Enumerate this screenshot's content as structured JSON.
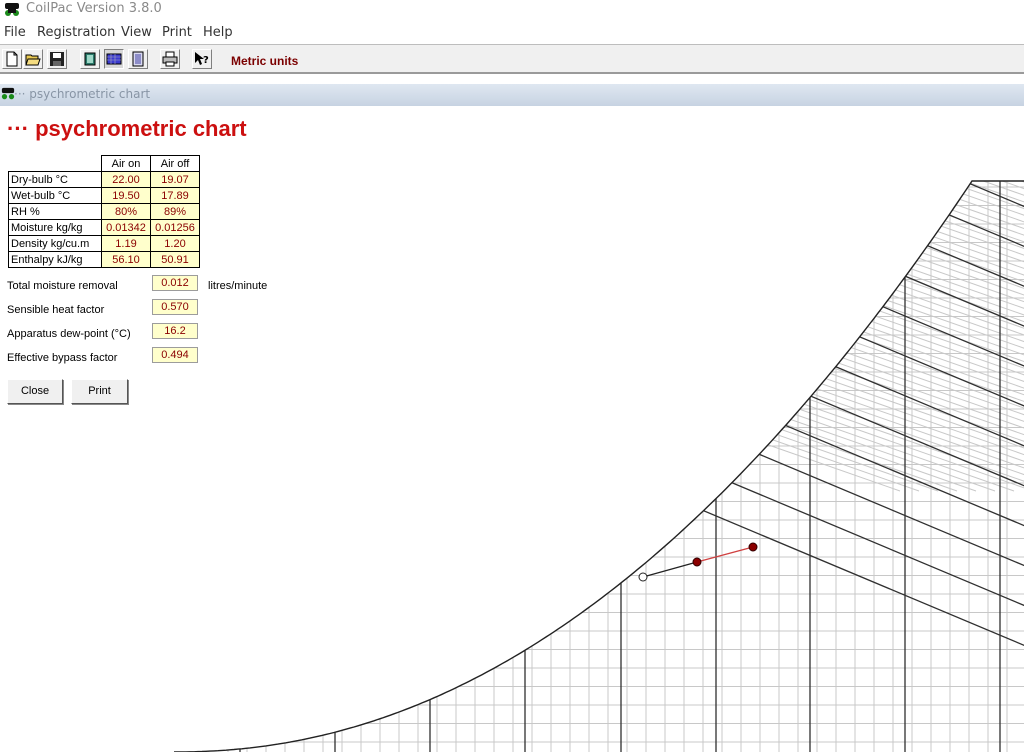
{
  "window": {
    "title": "CoilPac Version 3.8.0"
  },
  "menu": [
    "File",
    "Registration",
    "View",
    "Print",
    "Help"
  ],
  "toolbar": {
    "buttons": [
      "new-file-icon",
      "open-folder-icon",
      "save-icon",
      "coil-view-icon",
      "chart-view-icon",
      "report-view-icon",
      "printer-icon",
      "help-pointer-icon"
    ],
    "units_label": "Metric units"
  },
  "child_window": {
    "title": "··· psychrometric chart"
  },
  "page": {
    "title": "··· psychrometric chart"
  },
  "table": {
    "headers": [
      "",
      "Air on",
      "Air off"
    ],
    "rows": [
      {
        "label": "Dry-bulb °C",
        "air_on": "22.00",
        "air_off": "19.07"
      },
      {
        "label": "Wet-bulb °C",
        "air_on": "19.50",
        "air_off": "17.89"
      },
      {
        "label": "RH %",
        "air_on": "80%",
        "air_off": "89%"
      },
      {
        "label": "Moisture kg/kg",
        "air_on": "0.01342",
        "air_off": "0.01256"
      },
      {
        "label": "Density kg/cu.m",
        "air_on": "1.19",
        "air_off": "1.20"
      },
      {
        "label": "Enthalpy kJ/kg",
        "air_on": "56.10",
        "air_off": "50.91"
      }
    ]
  },
  "results": {
    "moisture_removal": {
      "label": "Total moisture removal",
      "value": "0.012",
      "unit": "litres/minute"
    },
    "sensible_heat_factor": {
      "label": "Sensible heat factor",
      "value": "0.570"
    },
    "dew_point": {
      "label": "Apparatus dew-point (°C)",
      "value": "16.2"
    },
    "bypass_factor": {
      "label": "Effective bypass factor",
      "value": "0.494"
    }
  },
  "buttons": {
    "close": "Close",
    "print": "Print"
  },
  "colors": {
    "title_red": "#cc1010",
    "value_bg": "#ffffcc",
    "value_text": "#8a0000",
    "process_line": "#d04040",
    "state_point": "#8b0000"
  }
}
